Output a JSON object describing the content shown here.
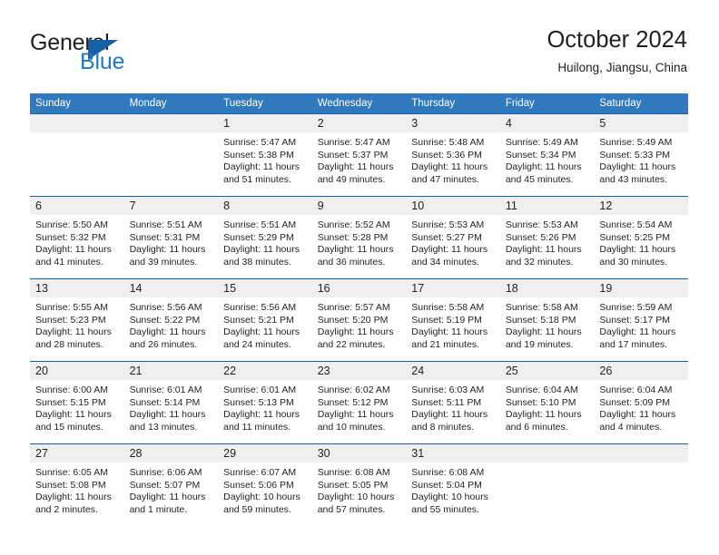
{
  "brand": {
    "name_part1": "General",
    "name_part2": "Blue",
    "triangle_color": "#1461a8",
    "blue_color": "#1f78c1"
  },
  "header": {
    "title": "October 2024",
    "subtitle": "Huilong, Jiangsu, China"
  },
  "theme": {
    "header_row_bg": "#3079bd",
    "daynum_bg": "#efefef",
    "cell_border": "#1461a8",
    "text": "#231f20"
  },
  "weekdays": [
    "Sunday",
    "Monday",
    "Tuesday",
    "Wednesday",
    "Thursday",
    "Friday",
    "Saturday"
  ],
  "weeks": [
    [
      {
        "day": "",
        "sunrise": "",
        "sunset": "",
        "daylight": ""
      },
      {
        "day": "",
        "sunrise": "",
        "sunset": "",
        "daylight": ""
      },
      {
        "day": "1",
        "sunrise": "Sunrise: 5:47 AM",
        "sunset": "Sunset: 5:38 PM",
        "daylight": "Daylight: 11 hours and 51 minutes."
      },
      {
        "day": "2",
        "sunrise": "Sunrise: 5:47 AM",
        "sunset": "Sunset: 5:37 PM",
        "daylight": "Daylight: 11 hours and 49 minutes."
      },
      {
        "day": "3",
        "sunrise": "Sunrise: 5:48 AM",
        "sunset": "Sunset: 5:36 PM",
        "daylight": "Daylight: 11 hours and 47 minutes."
      },
      {
        "day": "4",
        "sunrise": "Sunrise: 5:49 AM",
        "sunset": "Sunset: 5:34 PM",
        "daylight": "Daylight: 11 hours and 45 minutes."
      },
      {
        "day": "5",
        "sunrise": "Sunrise: 5:49 AM",
        "sunset": "Sunset: 5:33 PM",
        "daylight": "Daylight: 11 hours and 43 minutes."
      }
    ],
    [
      {
        "day": "6",
        "sunrise": "Sunrise: 5:50 AM",
        "sunset": "Sunset: 5:32 PM",
        "daylight": "Daylight: 11 hours and 41 minutes."
      },
      {
        "day": "7",
        "sunrise": "Sunrise: 5:51 AM",
        "sunset": "Sunset: 5:31 PM",
        "daylight": "Daylight: 11 hours and 39 minutes."
      },
      {
        "day": "8",
        "sunrise": "Sunrise: 5:51 AM",
        "sunset": "Sunset: 5:29 PM",
        "daylight": "Daylight: 11 hours and 38 minutes."
      },
      {
        "day": "9",
        "sunrise": "Sunrise: 5:52 AM",
        "sunset": "Sunset: 5:28 PM",
        "daylight": "Daylight: 11 hours and 36 minutes."
      },
      {
        "day": "10",
        "sunrise": "Sunrise: 5:53 AM",
        "sunset": "Sunset: 5:27 PM",
        "daylight": "Daylight: 11 hours and 34 minutes."
      },
      {
        "day": "11",
        "sunrise": "Sunrise: 5:53 AM",
        "sunset": "Sunset: 5:26 PM",
        "daylight": "Daylight: 11 hours and 32 minutes."
      },
      {
        "day": "12",
        "sunrise": "Sunrise: 5:54 AM",
        "sunset": "Sunset: 5:25 PM",
        "daylight": "Daylight: 11 hours and 30 minutes."
      }
    ],
    [
      {
        "day": "13",
        "sunrise": "Sunrise: 5:55 AM",
        "sunset": "Sunset: 5:23 PM",
        "daylight": "Daylight: 11 hours and 28 minutes."
      },
      {
        "day": "14",
        "sunrise": "Sunrise: 5:56 AM",
        "sunset": "Sunset: 5:22 PM",
        "daylight": "Daylight: 11 hours and 26 minutes."
      },
      {
        "day": "15",
        "sunrise": "Sunrise: 5:56 AM",
        "sunset": "Sunset: 5:21 PM",
        "daylight": "Daylight: 11 hours and 24 minutes."
      },
      {
        "day": "16",
        "sunrise": "Sunrise: 5:57 AM",
        "sunset": "Sunset: 5:20 PM",
        "daylight": "Daylight: 11 hours and 22 minutes."
      },
      {
        "day": "17",
        "sunrise": "Sunrise: 5:58 AM",
        "sunset": "Sunset: 5:19 PM",
        "daylight": "Daylight: 11 hours and 21 minutes."
      },
      {
        "day": "18",
        "sunrise": "Sunrise: 5:58 AM",
        "sunset": "Sunset: 5:18 PM",
        "daylight": "Daylight: 11 hours and 19 minutes."
      },
      {
        "day": "19",
        "sunrise": "Sunrise: 5:59 AM",
        "sunset": "Sunset: 5:17 PM",
        "daylight": "Daylight: 11 hours and 17 minutes."
      }
    ],
    [
      {
        "day": "20",
        "sunrise": "Sunrise: 6:00 AM",
        "sunset": "Sunset: 5:15 PM",
        "daylight": "Daylight: 11 hours and 15 minutes."
      },
      {
        "day": "21",
        "sunrise": "Sunrise: 6:01 AM",
        "sunset": "Sunset: 5:14 PM",
        "daylight": "Daylight: 11 hours and 13 minutes."
      },
      {
        "day": "22",
        "sunrise": "Sunrise: 6:01 AM",
        "sunset": "Sunset: 5:13 PM",
        "daylight": "Daylight: 11 hours and 11 minutes."
      },
      {
        "day": "23",
        "sunrise": "Sunrise: 6:02 AM",
        "sunset": "Sunset: 5:12 PM",
        "daylight": "Daylight: 11 hours and 10 minutes."
      },
      {
        "day": "24",
        "sunrise": "Sunrise: 6:03 AM",
        "sunset": "Sunset: 5:11 PM",
        "daylight": "Daylight: 11 hours and 8 minutes."
      },
      {
        "day": "25",
        "sunrise": "Sunrise: 6:04 AM",
        "sunset": "Sunset: 5:10 PM",
        "daylight": "Daylight: 11 hours and 6 minutes."
      },
      {
        "day": "26",
        "sunrise": "Sunrise: 6:04 AM",
        "sunset": "Sunset: 5:09 PM",
        "daylight": "Daylight: 11 hours and 4 minutes."
      }
    ],
    [
      {
        "day": "27",
        "sunrise": "Sunrise: 6:05 AM",
        "sunset": "Sunset: 5:08 PM",
        "daylight": "Daylight: 11 hours and 2 minutes."
      },
      {
        "day": "28",
        "sunrise": "Sunrise: 6:06 AM",
        "sunset": "Sunset: 5:07 PM",
        "daylight": "Daylight: 11 hours and 1 minute."
      },
      {
        "day": "29",
        "sunrise": "Sunrise: 6:07 AM",
        "sunset": "Sunset: 5:06 PM",
        "daylight": "Daylight: 10 hours and 59 minutes."
      },
      {
        "day": "30",
        "sunrise": "Sunrise: 6:08 AM",
        "sunset": "Sunset: 5:05 PM",
        "daylight": "Daylight: 10 hours and 57 minutes."
      },
      {
        "day": "31",
        "sunrise": "Sunrise: 6:08 AM",
        "sunset": "Sunset: 5:04 PM",
        "daylight": "Daylight: 10 hours and 55 minutes."
      },
      {
        "day": "",
        "sunrise": "",
        "sunset": "",
        "daylight": ""
      },
      {
        "day": "",
        "sunrise": "",
        "sunset": "",
        "daylight": ""
      }
    ]
  ]
}
